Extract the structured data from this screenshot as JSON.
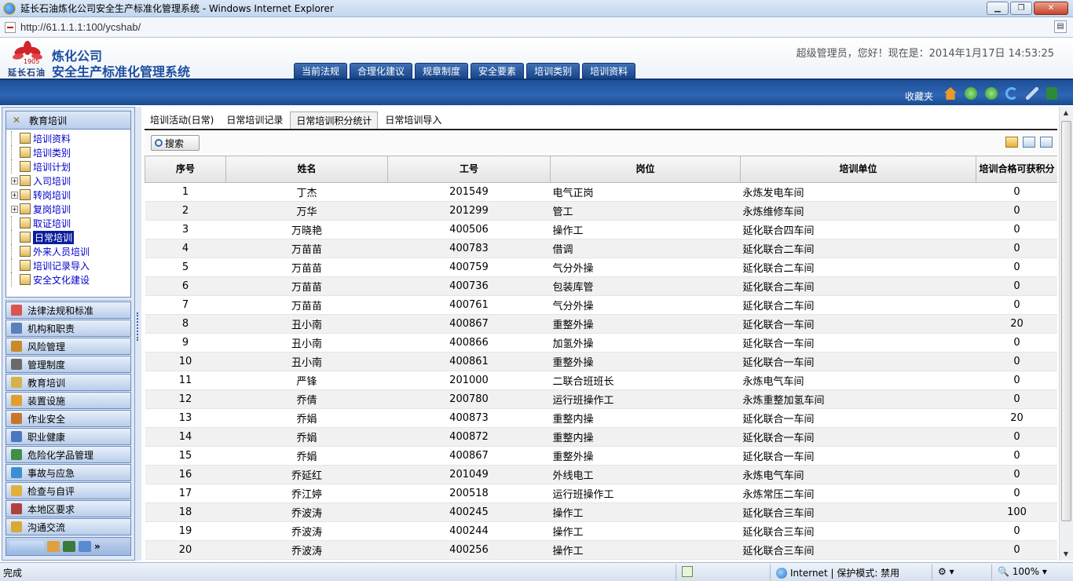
{
  "browser": {
    "window_title": "延长石油炼化公司安全生产标准化管理系统 - Windows Internet Explorer",
    "address": "http://61.1.1.1:100/ycshab/",
    "status_text": "完成",
    "zone_text": "Internet | 保护模式: 禁用",
    "zoom": "100%"
  },
  "header": {
    "logo_year": "1905",
    "logo_brand": "延长石油",
    "app_name_line1": "炼化公司",
    "app_name_line2": "安全生产标准化管理系统",
    "greeting": "超级管理员，您好！现在是：2014年1月17日 14:53:25",
    "nav_tabs": [
      "当前法规",
      "合理化建议",
      "规章制度",
      "安全要素",
      "培训类别",
      "培训资料"
    ],
    "favorites_label": "收藏夹"
  },
  "sidebar": {
    "open_section": "教育培训",
    "tree": [
      {
        "label": "培训资料",
        "expandable": false
      },
      {
        "label": "培训类别",
        "expandable": false
      },
      {
        "label": "培训计划",
        "expandable": false
      },
      {
        "label": "入司培训",
        "expandable": true
      },
      {
        "label": "转岗培训",
        "expandable": true
      },
      {
        "label": "复岗培训",
        "expandable": true
      },
      {
        "label": "取证培训",
        "expandable": false
      },
      {
        "label": "日常培训",
        "expandable": false,
        "selected": true
      },
      {
        "label": "外来人员培训",
        "expandable": false
      },
      {
        "label": "培训记录导入",
        "expandable": false
      },
      {
        "label": "安全文化建设",
        "expandable": false
      }
    ],
    "sections": [
      {
        "label": "法律法规和标准",
        "color": "#d9534f"
      },
      {
        "label": "机构和职责",
        "color": "#5b7fb8"
      },
      {
        "label": "风险管理",
        "color": "#c98a2a"
      },
      {
        "label": "管理制度",
        "color": "#6a6a6a"
      },
      {
        "label": "教育培训",
        "color": "#d6b04a"
      },
      {
        "label": "装置设施",
        "color": "#e0a030"
      },
      {
        "label": "作业安全",
        "color": "#c7762e"
      },
      {
        "label": "职业健康",
        "color": "#4a78c0"
      },
      {
        "label": "危险化学品管理",
        "color": "#3f8f46"
      },
      {
        "label": "事故与应急",
        "color": "#3a8fd0"
      },
      {
        "label": "检查与自评",
        "color": "#e0b040"
      },
      {
        "label": "本地区要求",
        "color": "#b04040"
      },
      {
        "label": "沟通交流",
        "color": "#d8a838"
      }
    ]
  },
  "main": {
    "tabs": [
      "培训活动(日常)",
      "日常培训记录",
      "日常培训积分统计",
      "日常培训导入"
    ],
    "active_tab": 2,
    "search_label": "搜索",
    "columns": [
      "序号",
      "姓名",
      "工号",
      "岗位",
      "培训单位",
      "培训合格可获积分"
    ],
    "rows": [
      [
        "1",
        "丁杰",
        "201549",
        "电气正岗",
        "永炼发电车间",
        "0"
      ],
      [
        "2",
        "万华",
        "201299",
        "管工",
        "永炼维修车间",
        "0"
      ],
      [
        "3",
        "万晓艳",
        "400506",
        "操作工",
        "延化联合四车间",
        "0"
      ],
      [
        "4",
        "万苗苗",
        "400783",
        "借调",
        "延化联合二车间",
        "0"
      ],
      [
        "5",
        "万苗苗",
        "400759",
        "气分外操",
        "延化联合二车间",
        "0"
      ],
      [
        "6",
        "万苗苗",
        "400736",
        "包装库管",
        "延化联合二车间",
        "0"
      ],
      [
        "7",
        "万苗苗",
        "400761",
        "气分外操",
        "延化联合二车间",
        "0"
      ],
      [
        "8",
        "丑小南",
        "400867",
        "重整外操",
        "延化联合一车间",
        "20"
      ],
      [
        "9",
        "丑小南",
        "400866",
        "加氢外操",
        "延化联合一车间",
        "0"
      ],
      [
        "10",
        "丑小南",
        "400861",
        "重整外操",
        "延化联合一车间",
        "0"
      ],
      [
        "11",
        "严锋",
        "201000",
        "二联合班班长",
        "永炼电气车间",
        "0"
      ],
      [
        "12",
        "乔倩",
        "200780",
        "运行班操作工",
        "永炼重整加氢车间",
        "0"
      ],
      [
        "13",
        "乔娟",
        "400873",
        "重整内操",
        "延化联合一车间",
        "20"
      ],
      [
        "14",
        "乔娟",
        "400872",
        "重整内操",
        "延化联合一车间",
        "0"
      ],
      [
        "15",
        "乔娟",
        "400867",
        "重整外操",
        "延化联合一车间",
        "0"
      ],
      [
        "16",
        "乔延红",
        "201049",
        "外线电工",
        "永炼电气车间",
        "0"
      ],
      [
        "17",
        "乔江婷",
        "200518",
        "运行班操作工",
        "永炼常压二车间",
        "0"
      ],
      [
        "18",
        "乔波涛",
        "400245",
        "操作工",
        "延化联合三车间",
        "100"
      ],
      [
        "19",
        "乔波涛",
        "400244",
        "操作工",
        "延化联合三车间",
        "0"
      ],
      [
        "20",
        "乔波涛",
        "400256",
        "操作工",
        "延化联合三车间",
        "0"
      ]
    ]
  }
}
